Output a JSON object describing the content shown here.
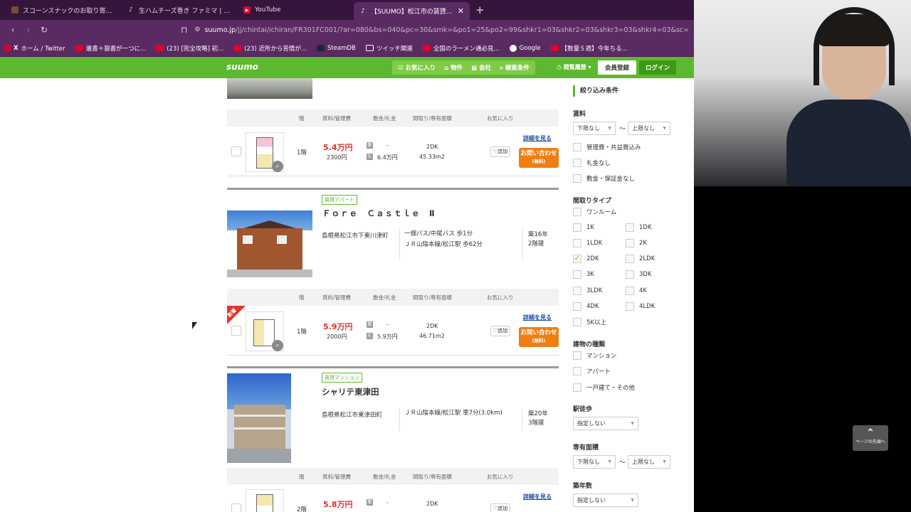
{
  "browser": {
    "tabs": [
      {
        "title": "スコーンスナックのお取り寄せ | 公式通販",
        "icon": "tab-site-icon"
      },
      {
        "title": "生ハムチーズ巻き ファミマ | TikTok",
        "icon": "tiktok-icon"
      },
      {
        "title": "YouTube",
        "icon": "youtube-icon"
      },
      {
        "title": "【SUUMO】松江市の賃貸(賃貸マン",
        "icon": "suumo-tab-icon",
        "active": true
      }
    ],
    "url_host": "suumo.jp",
    "url_path": "/jj/chintai/ichiran/FR301FC001/?ar=080&bs=040&pc=30&smk=&po1=25&po2=99&shkr1=03&shkr2=03&shkr3=03&shkr4=03&sc=32201&ta=32&...",
    "bookmarks": [
      "ホーム / Twitter",
      "遺書＋狼書が一つに...",
      "(23) [完全攻略] 初...",
      "(23) 近所から苦情が...",
      "SteamDB",
      "ツイッチ関連",
      "全国のラーメン通必見...",
      "Google",
      "【数量５週】今年ちる..."
    ]
  },
  "header": {
    "logo": "suumo",
    "nav": [
      "お気に入り",
      "物件",
      "会社",
      "検索条件"
    ],
    "history": "閲覧履歴",
    "register": "会員登録",
    "login": "ログイン"
  },
  "table_headers": [
    "階",
    "賃料/管理費",
    "敷金/礼金",
    "間取り/専有面積",
    "お気に入り"
  ],
  "common": {
    "detail": "詳細を見る",
    "inquire": "お問い合わせ",
    "inquire_free": "(無料)",
    "fav": "♡追加"
  },
  "listings": [
    {
      "units": [
        {
          "floor": "1階",
          "rent": "5.4万円",
          "admin": "2300円",
          "deposit": "-",
          "key_money": "6.4万円",
          "layout": "2DK",
          "area": "45.33m2"
        }
      ]
    },
    {
      "type": "賃貸アパート",
      "name": "Ｆｏｒｅ　Ｃａｓｔｌｅ　Ⅱ",
      "address": "島根県松江市下東川津町",
      "access": [
        "一畑バス/中尾バス 歩1分",
        "ＪＲ山陰本線/松江駅 歩62分"
      ],
      "age": "築16年",
      "stories": "2階建",
      "units": [
        {
          "floor": "1階",
          "rent": "5.9万円",
          "admin": "2000円",
          "deposit": "-",
          "key_money": "5.9万円",
          "layout": "2DK",
          "area": "46.71m2",
          "badge": "新着"
        }
      ]
    },
    {
      "type": "賃貸マンション",
      "name": "シャリテ東津田",
      "address": "島根県松江市東津田町",
      "access": [
        "ＪＲ山陰本線/松江駅 車7分(3.0km)"
      ],
      "age": "築20年",
      "stories": "3階建",
      "units": [
        {
          "floor": "2階",
          "rent": "5.8万円",
          "deposit": "-",
          "layout": "2DK"
        }
      ]
    }
  ],
  "sidebar": {
    "title": "絞り込み条件",
    "rent_label": "賃料",
    "min": "下限なし",
    "max": "上限なし",
    "tilde": "〜",
    "rent_options": [
      "管理費・共益費込み",
      "礼金なし",
      "敷金・保証金なし"
    ],
    "layout_label": "間取りタイプ",
    "layouts": [
      "ワンルーム",
      "1K",
      "1DK",
      "1LDK",
      "2K",
      "2DK",
      "2LDK",
      "3K",
      "3DK",
      "3LDK",
      "4K",
      "4DK",
      "4LDK",
      "5K以上"
    ],
    "checked_layout": "2DK",
    "building_label": "建物の種類",
    "buildings": [
      "マンション",
      "アパート",
      "一戸建て・その他"
    ],
    "walk_label": "駅徒歩",
    "unspecified": "指定しない",
    "area_label": "専有面積",
    "age_label": "築年数"
  },
  "scrolltop": "ページの先頭へ"
}
